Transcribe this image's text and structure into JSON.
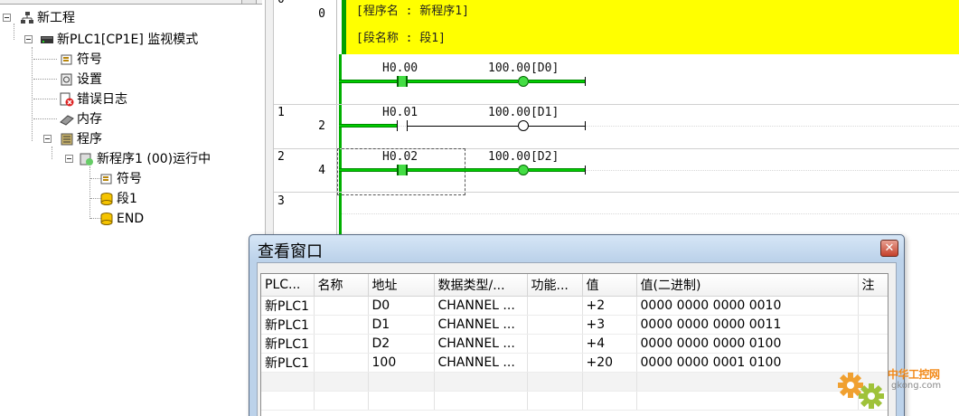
{
  "tree": {
    "root": "新工程",
    "plc": "新PLC1[CP1E] 监视模式",
    "symbols": "符号",
    "settings": "设置",
    "error_log": "错误日志",
    "memory": "内存",
    "programs": "程序",
    "program1": "新程序1 (00)运行中",
    "program1_symbols": "符号",
    "section1": "段1",
    "end": "END"
  },
  "ladder": {
    "comment_program": "[程序名 : 新程序1]",
    "comment_section": "[段名称 : 段1]",
    "rungs": [
      {
        "num": "0",
        "step": "0",
        "contact": "H0.00",
        "coil": "100.00[D0]",
        "state": "on"
      },
      {
        "num": "1",
        "step": "2",
        "contact": "H0.01",
        "coil": "100.00[D1]",
        "state": "off"
      },
      {
        "num": "2",
        "step": "4",
        "contact": "H0.02",
        "coil": "100.00[D2]",
        "state": "on"
      },
      {
        "num": "3",
        "step": ""
      }
    ],
    "colors": {
      "energized": "#00cc00",
      "comment_bg": "#ffff00"
    }
  },
  "watch": {
    "title": "查看窗口",
    "close_label": "✕",
    "columns": [
      "PLC...",
      "名称",
      "地址",
      "数据类型/...",
      "功能...",
      "值",
      "值(二进制)",
      "注"
    ],
    "rows": [
      [
        "新PLC1",
        "",
        "D0",
        "CHANNEL ...",
        "",
        "+2",
        "0000 0000 0000 0010",
        ""
      ],
      [
        "新PLC1",
        "",
        "D1",
        "CHANNEL ...",
        "",
        "+3",
        "0000 0000 0000 0011",
        ""
      ],
      [
        "新PLC1",
        "",
        "D2",
        "CHANNEL ...",
        "",
        "+4",
        "0000 0000 0000 0100",
        ""
      ],
      [
        "新PLC1",
        "",
        "100",
        "CHANNEL ...",
        "",
        "+20",
        "0000 0000 0001 0100",
        ""
      ]
    ]
  },
  "watermark": {
    "cn": "中华工控网",
    "en": "gkong.com"
  }
}
